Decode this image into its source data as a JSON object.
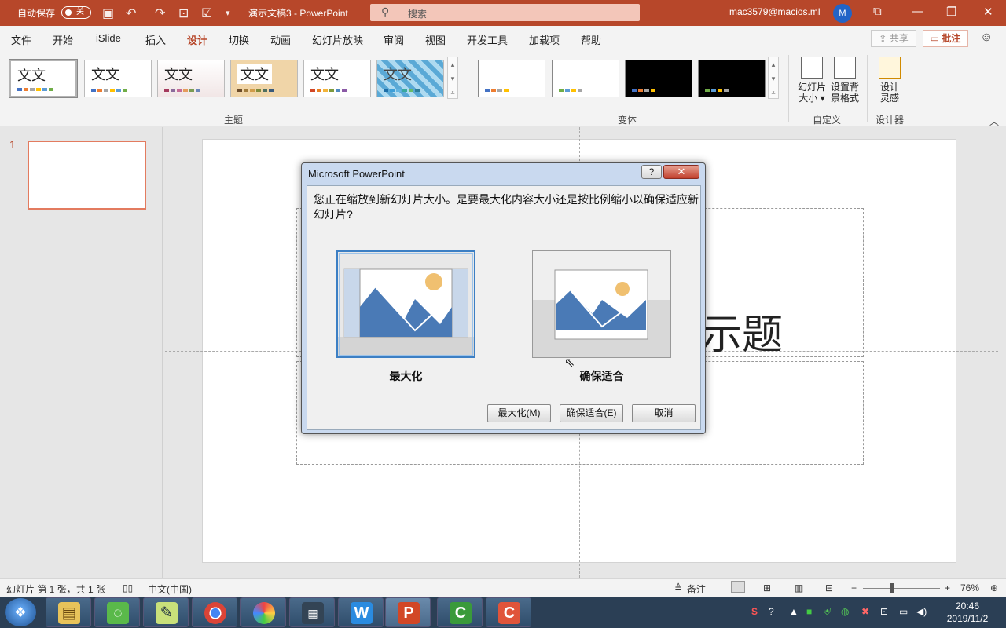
{
  "titlebar": {
    "autosave_label": "自动保存",
    "autosave_state": "关",
    "doc_title": "演示文稿3 - PowerPoint",
    "search_placeholder": "搜索",
    "account": "mac3579@macios.ml",
    "avatar_initial": "M",
    "bg_color": "#b7472a"
  },
  "menu": {
    "tabs": [
      "文件",
      "开始",
      "iSlide",
      "插入",
      "设计",
      "切换",
      "动画",
      "幻灯片放映",
      "审阅",
      "视图",
      "开发工具",
      "加载项",
      "帮助"
    ],
    "active_tab": "设计",
    "share_label": "共享",
    "comments_label": "批注"
  },
  "ribbon": {
    "themes": [
      {
        "text": "文文"
      },
      {
        "text": "文文"
      },
      {
        "text": "文文"
      },
      {
        "text": "文文"
      },
      {
        "text": "文文"
      },
      {
        "text": "文文"
      }
    ],
    "group_themes": "主题",
    "group_variants": "变体",
    "group_customize": "自定义",
    "group_designer": "设计器",
    "slide_size_label1": "幻灯片",
    "slide_size_label2": "大小",
    "bg_format_label1": "设置背",
    "bg_format_label2": "景格式",
    "design_ideas_label1": "设计",
    "design_ideas_label2": "灵感"
  },
  "thumbnails": {
    "slide_number": "1"
  },
  "slide": {
    "title_glyph": "示题"
  },
  "dialog": {
    "title": "Microsoft PowerPoint",
    "help": "?",
    "close": "✕",
    "message": "您正在缩放到新幻灯片大小。是要最大化内容大小还是按比例缩小以确保适应新幻灯片?",
    "option_maximize": "最大化",
    "option_ensure_fit": "确保适合",
    "btn_maximize": "最大化(M)",
    "btn_ensure_fit": "确保适合(E)",
    "btn_cancel": "取消",
    "selected_option": "最大化"
  },
  "statusbar": {
    "slide_info": "幻灯片 第 1 张，共 1 张",
    "language": "中文(中国)",
    "notes": "备注",
    "zoom": "76%"
  },
  "taskbar": {
    "apps": [
      "文件资源管理器",
      "微信",
      "记事本",
      "Chrome",
      "浏览器",
      "终端",
      "WPS",
      "PowerPoint",
      "Camtasia",
      "Camtasia"
    ],
    "time": "20:46",
    "date": "2019/11/2"
  },
  "colors": {
    "accent": "#b7472a",
    "dialog_frame": "#c9d9ef",
    "selection": "#3c7fc4"
  }
}
